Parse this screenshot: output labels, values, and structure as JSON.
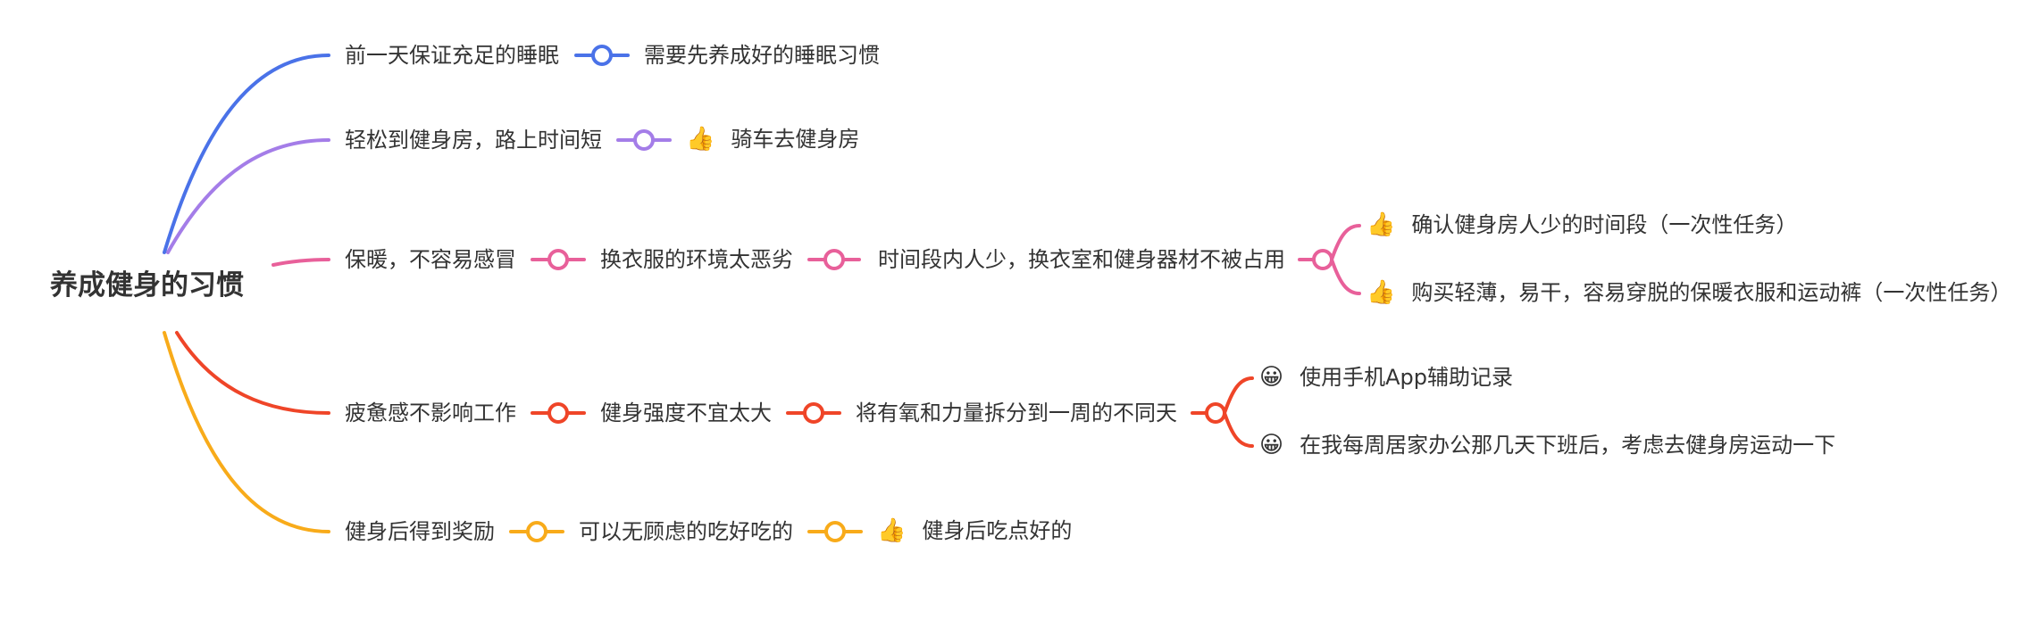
{
  "root": {
    "label": "养成健身的习惯"
  },
  "colors": {
    "text": "#333333",
    "blue": "#4a72e8",
    "purple": "#a47de8",
    "pink": "#e8609a",
    "red": "#ef4528",
    "orange": "#f8ab1a"
  },
  "icons": {
    "thumbs_up": "👍",
    "grin": "😀"
  },
  "branches": [
    {
      "color_key": "blue",
      "nodes": [
        {
          "label": "前一天保证充足的睡眠"
        },
        {
          "label": "需要先养成好的睡眠习惯"
        }
      ]
    },
    {
      "color_key": "purple",
      "nodes": [
        {
          "label": "轻松到健身房，路上时间短"
        },
        {
          "label": "骑车去健身房",
          "icon": "thumbs-up-icon"
        }
      ]
    },
    {
      "color_key": "pink",
      "nodes": [
        {
          "label": "保暖，不容易感冒"
        },
        {
          "label": "换衣服的环境太恶劣"
        },
        {
          "label": "时间段内人少，换衣室和健身器材不被占用"
        }
      ],
      "leaves": [
        {
          "label": "确认健身房人少的时间段（一次性任务）",
          "icon": "thumbs-up-icon"
        },
        {
          "label": "购买轻薄，易干，容易穿脱的保暖衣服和运动裤（一次性任务）",
          "icon": "thumbs-up-icon"
        }
      ]
    },
    {
      "color_key": "red",
      "nodes": [
        {
          "label": "疲惫感不影响工作"
        },
        {
          "label": "健身强度不宜太大"
        },
        {
          "label": "将有氧和力量拆分到一周的不同天"
        }
      ],
      "leaves": [
        {
          "label": "使用手机App辅助记录",
          "icon": "grin-icon"
        },
        {
          "label": "在我每周居家办公那几天下班后，考虑去健身房运动一下",
          "icon": "grin-icon"
        }
      ]
    },
    {
      "color_key": "orange",
      "nodes": [
        {
          "label": "健身后得到奖励"
        },
        {
          "label": "可以无顾虑的吃好吃的"
        },
        {
          "label": "健身后吃点好的",
          "icon": "thumbs-up-icon"
        }
      ]
    }
  ]
}
